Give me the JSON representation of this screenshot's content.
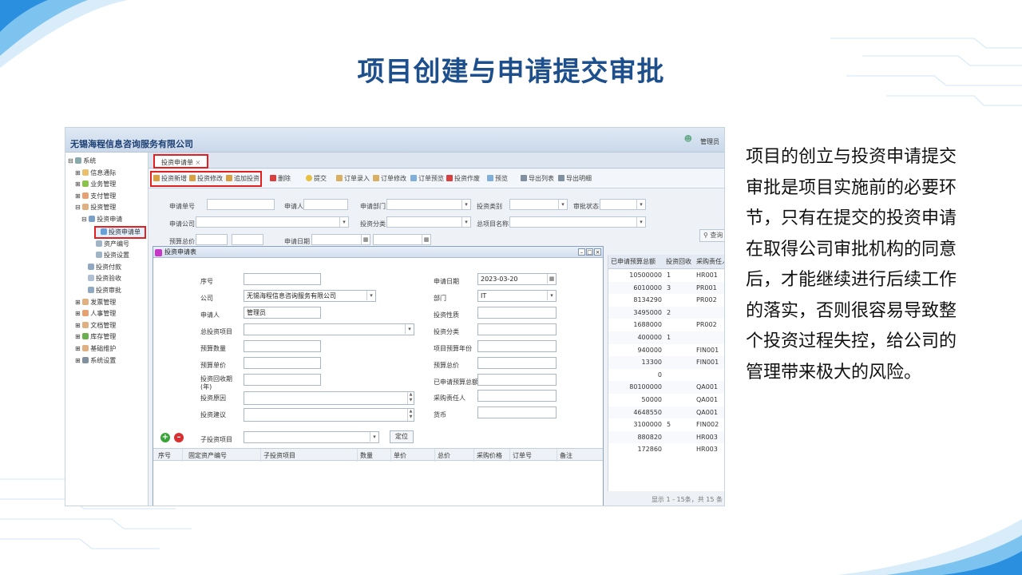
{
  "slide": {
    "title": "项目创建与申请提交审批",
    "description": "项目的创立与投资申请提交审批是项目实施前的必要环节，只有在提交的投资申请在取得公司审批机构的同意后，才能继续进行后续工作的落实，否则很容易导致整个投资过程失控，给公司的管理带来极大的风险。"
  },
  "app": {
    "company": "无锡海程信息咨询服务有限公司",
    "user": "管理员",
    "sidebar": [
      {
        "label": "系统",
        "icon": "system-icon"
      },
      {
        "label": "信息通际",
        "icon": "info-icon"
      },
      {
        "label": "业务管理",
        "icon": "business-icon"
      },
      {
        "label": "支付管理",
        "icon": "payment-icon"
      },
      {
        "label": "投资管理",
        "icon": "invest-icon"
      },
      {
        "label": "投资申请",
        "icon": "folder-icon"
      },
      {
        "label": "投资申请单",
        "icon": "form-icon"
      },
      {
        "label": "资产编号",
        "icon": "asset-icon"
      },
      {
        "label": "投资设置",
        "icon": "settings-icon"
      },
      {
        "label": "投资付款",
        "icon": "pay-icon"
      },
      {
        "label": "投资验收",
        "icon": "check-icon"
      },
      {
        "label": "投资审批",
        "icon": "approve-icon"
      },
      {
        "label": "发票管理",
        "icon": "invoice-icon"
      },
      {
        "label": "人事管理",
        "icon": "hr-icon"
      },
      {
        "label": "文档管理",
        "icon": "doc-icon"
      },
      {
        "label": "库存管理",
        "icon": "stock-icon"
      },
      {
        "label": "基础维护",
        "icon": "base-icon"
      },
      {
        "label": "系统设置",
        "icon": "gear-icon"
      }
    ],
    "tab": "投资申请单",
    "toolbar": [
      "投资新增",
      "投资修改",
      "追加投资",
      "删除",
      "提交",
      "订单录入",
      "订单修改",
      "订单预览",
      "投资作废",
      "预览",
      "导出列表",
      "导出明细"
    ],
    "filters": {
      "apply_no": "申请单号",
      "applicant": "申请人",
      "dept": "申请部门",
      "type": "投资类别",
      "status": "审批状态",
      "company": "申请公司",
      "category": "投资分类",
      "project_name": "总项目名称",
      "budget_total": "预算总价",
      "apply_date": "申请日期",
      "search": "查询"
    },
    "grid": {
      "headers": [
        "已申请预算总额",
        "投资回收",
        "采购责任人"
      ],
      "rows": [
        [
          "10500000",
          "1",
          "HR001"
        ],
        [
          "6010000",
          "3",
          "PR001"
        ],
        [
          "8134290",
          "",
          "PR002"
        ],
        [
          "3495000",
          "2",
          ""
        ],
        [
          "1688000",
          "",
          "PR002"
        ],
        [
          "400000",
          "1",
          ""
        ],
        [
          "940000",
          "",
          "FIN001"
        ],
        [
          "13300",
          "",
          "FIN001"
        ],
        [
          "0",
          "",
          ""
        ],
        [
          "80100000",
          "",
          "QA001"
        ],
        [
          "50000",
          "",
          "QA001"
        ],
        [
          "4648550",
          "",
          "QA001"
        ],
        [
          "3100000",
          "5",
          "FIN002"
        ],
        [
          "880820",
          "",
          "HR003"
        ],
        [
          "172860",
          "",
          "HR003"
        ]
      ],
      "footer": "显示 1 - 15条，共 15 条"
    },
    "dialog": {
      "title": "投资申请表",
      "labels": {
        "seq": "序号",
        "company": "公司",
        "applicant": "申请人",
        "project": "总投资项目",
        "budget_qty": "预算数量",
        "budget_price": "预算单价",
        "payback": "投资回收期(年)",
        "reason": "投资原因",
        "advice": "投资建议",
        "apply_date": "申请日期",
        "dept": "部门",
        "nature": "投资性质",
        "category": "投资分类",
        "budget_year": "项目预算年份",
        "budget_total": "预算总价",
        "applied_total": "已申请预算总额",
        "buyer": "采购责任人",
        "currency": "货币",
        "sub_project": "子投资项目",
        "locate": "定位"
      },
      "values": {
        "company": "无锡海程信息咨询服务有限公司",
        "applicant": "管理员",
        "apply_date": "2023-03-20",
        "dept": "IT"
      },
      "grid_headers": [
        "序号",
        "固定资产编号",
        "子投资项目",
        "数量",
        "单价",
        "总价",
        "采购价格",
        "订单号",
        "备注"
      ]
    }
  }
}
